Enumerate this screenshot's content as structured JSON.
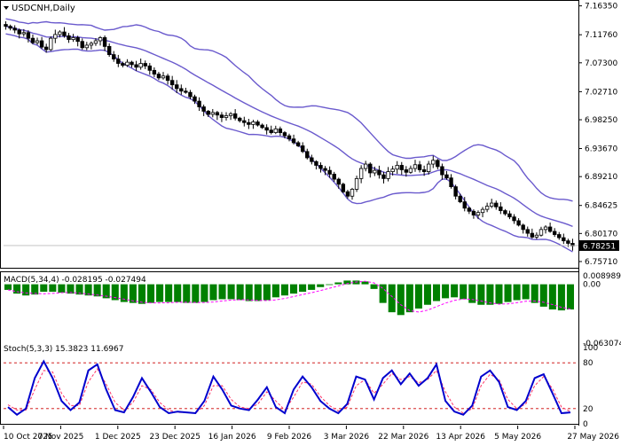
{
  "symbol_title": "USDCNH,Daily",
  "dropdown_icon": "triangle-down-icon",
  "price": {
    "ticks": [
      "7.16350",
      "7.11760",
      "7.07300",
      "7.02710",
      "6.98250",
      "6.93670",
      "6.89210",
      "6.84625",
      "6.80170",
      "6.75710"
    ],
    "tick_values": [
      7.1635,
      7.1176,
      7.073,
      7.0271,
      6.9825,
      6.9367,
      6.8921,
      6.84625,
      6.8017,
      6.7571
    ],
    "current_label": "6.78251",
    "current_value": 6.78251,
    "ylim": [
      6.75,
      7.17
    ]
  },
  "macd": {
    "title": "MACD(5,34,4) -0.028195 -0.027494",
    "ticks": [
      "0.008989",
      "0.00",
      "-0.063074"
    ],
    "tick_values": [
      0.008989,
      0.0,
      -0.063074
    ],
    "ylim": [
      -0.066,
      0.012
    ]
  },
  "stoch": {
    "title": "Stoch(5,3,3) 15.3823 11.6967",
    "ticks": [
      "100",
      "80",
      "20",
      "0"
    ],
    "tick_values": [
      100,
      80,
      20,
      0
    ],
    "levels": [
      80,
      20
    ]
  },
  "dates": [
    "10 Oct 2025",
    "7 Nov 2025",
    "1 Dec 2025",
    "23 Dec 2025",
    "16 Jan 2026",
    "9 Feb 2026",
    "3 Mar 2026",
    "22 Mar 2026",
    "13 Apr 2026",
    "5 May 2026",
    "27 May 2026"
  ],
  "colors": {
    "bands": "#6a5acd",
    "macd_hist": "#008000",
    "macd_signal": "#ff00ff",
    "stoch_main": "#0000cd",
    "stoch_signal": "#ff3366",
    "level_line": "#cc0000",
    "candle": "#000000"
  },
  "chart_data": [
    {
      "type": "candlestick",
      "name": "USDCNH",
      "series": [
        {
          "name": "close",
          "values": [
            7.131,
            7.128,
            7.125,
            7.119,
            7.121,
            7.112,
            7.105,
            7.108,
            7.098,
            7.094,
            7.112,
            7.118,
            7.122,
            7.116,
            7.11,
            7.113,
            7.107,
            7.097,
            7.101,
            7.104,
            7.108,
            7.113,
            7.099,
            7.086,
            7.079,
            7.072,
            7.069,
            7.074,
            7.07,
            7.066,
            7.072,
            7.068,
            7.061,
            7.055,
            7.049,
            7.052,
            7.045,
            7.038,
            7.032,
            7.028,
            7.026,
            7.019,
            7.012,
            7.003,
            6.996,
            6.991,
            6.994,
            6.99,
            6.986,
            6.989,
            6.992,
            6.985,
            6.981,
            6.978,
            6.975,
            6.979,
            6.974,
            6.97,
            6.966,
            6.962,
            6.968,
            6.962,
            6.957,
            6.952,
            6.946,
            6.941,
            6.932,
            6.922,
            6.916,
            6.91,
            6.905,
            6.902,
            6.896,
            6.888,
            6.88,
            6.868,
            6.861,
            6.872,
            6.889,
            6.905,
            6.912,
            6.898,
            6.902,
            6.895,
            6.889,
            6.9,
            6.904,
            6.91,
            6.903,
            6.899,
            6.905,
            6.911,
            6.903,
            6.9,
            6.912,
            6.918,
            6.908,
            6.895,
            6.89,
            6.876,
            6.861,
            6.852,
            6.842,
            6.837,
            6.831,
            6.835,
            6.84,
            6.845,
            6.85,
            6.844,
            6.838,
            6.833,
            6.828,
            6.822,
            6.815,
            6.808,
            6.802,
            6.796,
            6.799,
            6.808,
            6.812,
            6.805,
            6.8,
            6.795,
            6.79,
            6.786,
            6.782
          ]
        }
      ]
    },
    {
      "type": "bar",
      "name": "MACD histogram",
      "series": [
        {
          "name": "signal",
          "values": [
            -0.006,
            -0.01,
            -0.012,
            -0.011,
            -0.008,
            -0.008,
            -0.009,
            -0.01,
            -0.011,
            -0.012,
            -0.013,
            -0.015,
            -0.017,
            -0.019,
            -0.02,
            -0.021,
            -0.02,
            -0.019,
            -0.019,
            -0.019,
            -0.02,
            -0.02,
            -0.019,
            -0.017,
            -0.016,
            -0.016,
            -0.017,
            -0.018,
            -0.018,
            -0.017,
            -0.014,
            -0.012,
            -0.01,
            -0.008,
            -0.006,
            -0.003,
            0.0,
            0.002,
            0.004,
            0.004,
            0.003,
            -0.005,
            -0.02,
            -0.03,
            -0.033,
            -0.03,
            -0.026,
            -0.022,
            -0.018,
            -0.015,
            -0.014,
            -0.016,
            -0.02,
            -0.022,
            -0.022,
            -0.021,
            -0.019,
            -0.017,
            -0.016,
            -0.02,
            -0.024,
            -0.027,
            -0.028,
            -0.027
          ]
        }
      ]
    },
    {
      "type": "line",
      "name": "Stochastic",
      "series": [
        {
          "name": "main",
          "values": [
            22,
            12,
            20,
            60,
            82,
            60,
            30,
            18,
            28,
            70,
            78,
            45,
            18,
            15,
            35,
            60,
            42,
            22,
            14,
            16,
            15,
            14,
            30,
            62,
            45,
            24,
            20,
            18,
            32,
            48,
            22,
            14,
            45,
            62,
            48,
            30,
            20,
            14,
            26,
            62,
            58,
            32,
            60,
            70,
            52,
            66,
            50,
            60,
            78,
            30,
            16,
            12,
            24,
            62,
            70,
            55,
            22,
            18,
            30,
            60,
            65,
            40,
            14,
            15
          ]
        },
        {
          "name": "signal",
          "values": [
            25,
            18,
            18,
            45,
            70,
            68,
            40,
            24,
            24,
            55,
            72,
            52,
            28,
            18,
            28,
            50,
            45,
            28,
            18,
            15,
            15,
            14,
            24,
            50,
            50,
            32,
            22,
            20,
            26,
            42,
            30,
            18,
            35,
            55,
            52,
            36,
            24,
            17,
            22,
            50,
            58,
            40,
            52,
            66,
            58,
            62,
            54,
            58,
            70,
            42,
            22,
            14,
            20,
            50,
            65,
            58,
            32,
            20,
            26,
            50,
            62,
            46,
            22,
            16
          ]
        }
      ]
    }
  ]
}
